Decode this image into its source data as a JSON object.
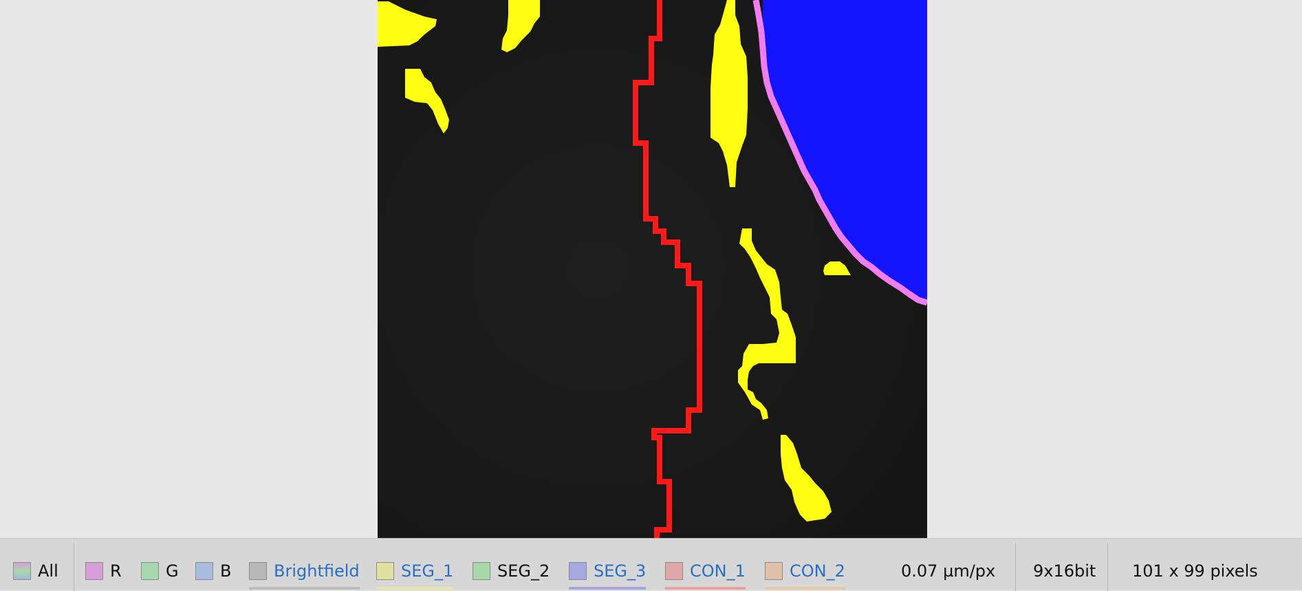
{
  "image": {
    "background_color": "#1a1a1a",
    "colors": {
      "yellow_blobs": "#ffff14",
      "red_contour": "#ff1a1a",
      "blue_region": "#1414ff",
      "pink_contour": "#f07ef0"
    }
  },
  "status_bar": {
    "channels": [
      {
        "label": "All",
        "swatch": "#d8a0d8",
        "link": false,
        "underline": null
      },
      {
        "label": "R",
        "swatch": "#d8a0d8",
        "link": false,
        "underline": null
      },
      {
        "label": "G",
        "swatch": "#a8d8b0",
        "link": false,
        "underline": null
      },
      {
        "label": "B",
        "swatch": "#a8bce0",
        "link": false,
        "underline": null
      },
      {
        "label": "Brightfield",
        "swatch": "#b8b8b8",
        "link": true,
        "underline": "#bdbdbd"
      },
      {
        "label": "SEG_1",
        "swatch": "#e0e0a0",
        "link": true,
        "underline": "#e6e6a8"
      },
      {
        "label": "SEG_2",
        "swatch": "#a8d8a8",
        "link": false,
        "underline": null
      },
      {
        "label": "SEG_3",
        "swatch": "#a8a8e0",
        "link": true,
        "underline": "#a8a8e0"
      },
      {
        "label": "CON_1",
        "swatch": "#e0a8a8",
        "link": true,
        "underline": "#e8a0a0"
      },
      {
        "label": "CON_2",
        "swatch": "#e0c0a8",
        "link": true,
        "underline": "#e8c8a8"
      }
    ],
    "scale": "0.07 µm/px",
    "bit_depth": "9x16bit",
    "dimensions": "101 x 99 pixels"
  }
}
